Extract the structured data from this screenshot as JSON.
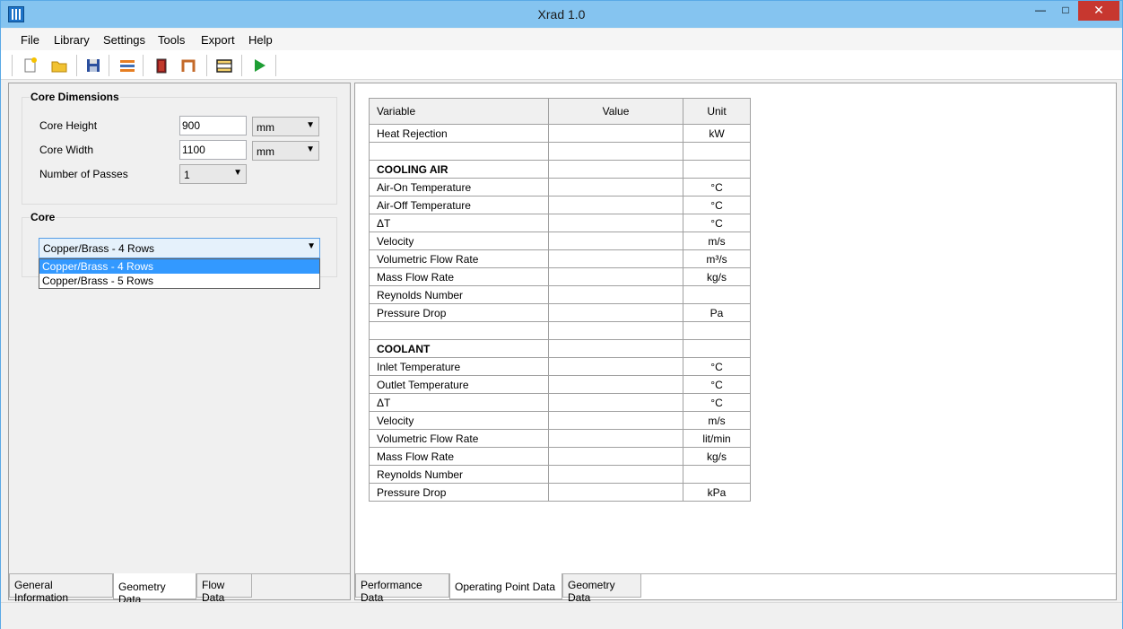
{
  "window": {
    "title": "Xrad 1.0",
    "min_glyph": "—",
    "max_glyph": "□",
    "close_glyph": "✕"
  },
  "menu": [
    "File",
    "Library",
    "Settings",
    "Tools",
    "Export",
    "Help"
  ],
  "toolbar": {
    "buttons": [
      "new-file-icon",
      "open-folder-icon",
      "save-icon",
      "layers-icon",
      "core-icon",
      "fin-icon",
      "panel-icon",
      "run-icon"
    ]
  },
  "left": {
    "core_dimensions": {
      "label": "Core Dimensions",
      "core_height_label": "Core Height",
      "core_height_value": "900",
      "core_height_unit": "mm",
      "core_width_label": "Core Width",
      "core_width_value": "1100",
      "core_width_unit": "mm",
      "passes_label": "Number of Passes",
      "passes_value": "1"
    },
    "core": {
      "label": "Core",
      "selected": "Copper/Brass - 4 Rows",
      "options": [
        "Copper/Brass - 4 Rows",
        "Copper/Brass - 5 Rows"
      ]
    },
    "tabs": [
      "General Information",
      "Geometry Data",
      "Flow Data"
    ],
    "active_tab": "Geometry Data"
  },
  "right": {
    "table": {
      "headers": [
        "Variable",
        "Value",
        "Unit"
      ],
      "rows": [
        {
          "variable": "Heat Rejection",
          "value": "",
          "unit": "kW",
          "bold": false
        },
        {
          "variable": "",
          "value": "",
          "unit": "",
          "bold": false
        },
        {
          "variable": "COOLING AIR",
          "value": "",
          "unit": "",
          "bold": true
        },
        {
          "variable": "Air-On Temperature",
          "value": "",
          "unit": "°C",
          "bold": false
        },
        {
          "variable": "Air-Off Temperature",
          "value": "",
          "unit": "°C",
          "bold": false
        },
        {
          "variable": "ΔT",
          "value": "",
          "unit": "°C",
          "bold": false
        },
        {
          "variable": "Velocity",
          "value": "",
          "unit": "m/s",
          "bold": false
        },
        {
          "variable": "Volumetric Flow Rate",
          "value": "",
          "unit": "m³/s",
          "bold": false
        },
        {
          "variable": "Mass Flow Rate",
          "value": "",
          "unit": "kg/s",
          "bold": false
        },
        {
          "variable": "Reynolds Number",
          "value": "",
          "unit": "",
          "bold": false
        },
        {
          "variable": "Pressure Drop",
          "value": "",
          "unit": "Pa",
          "bold": false
        },
        {
          "variable": "",
          "value": "",
          "unit": "",
          "bold": false
        },
        {
          "variable": "COOLANT",
          "value": "",
          "unit": "",
          "bold": true
        },
        {
          "variable": "Inlet Temperature",
          "value": "",
          "unit": "°C",
          "bold": false
        },
        {
          "variable": "Outlet Temperature",
          "value": "",
          "unit": "°C",
          "bold": false
        },
        {
          "variable": "ΔT",
          "value": "",
          "unit": "°C",
          "bold": false
        },
        {
          "variable": "Velocity",
          "value": "",
          "unit": "m/s",
          "bold": false
        },
        {
          "variable": "Volumetric Flow Rate",
          "value": "",
          "unit": "lit/min",
          "bold": false
        },
        {
          "variable": "Mass Flow Rate",
          "value": "",
          "unit": "kg/s",
          "bold": false
        },
        {
          "variable": "Reynolds Number",
          "value": "",
          "unit": "",
          "bold": false
        },
        {
          "variable": "Pressure Drop",
          "value": "",
          "unit": "kPa",
          "bold": false
        }
      ]
    },
    "tabs": [
      "Performance Data",
      "Operating Point Data",
      "Geometry Data"
    ],
    "active_tab": "Operating Point Data"
  },
  "colors": {
    "titlebar": "#85c4f0",
    "close_button": "#c7372f",
    "selection": "#3399ff"
  }
}
